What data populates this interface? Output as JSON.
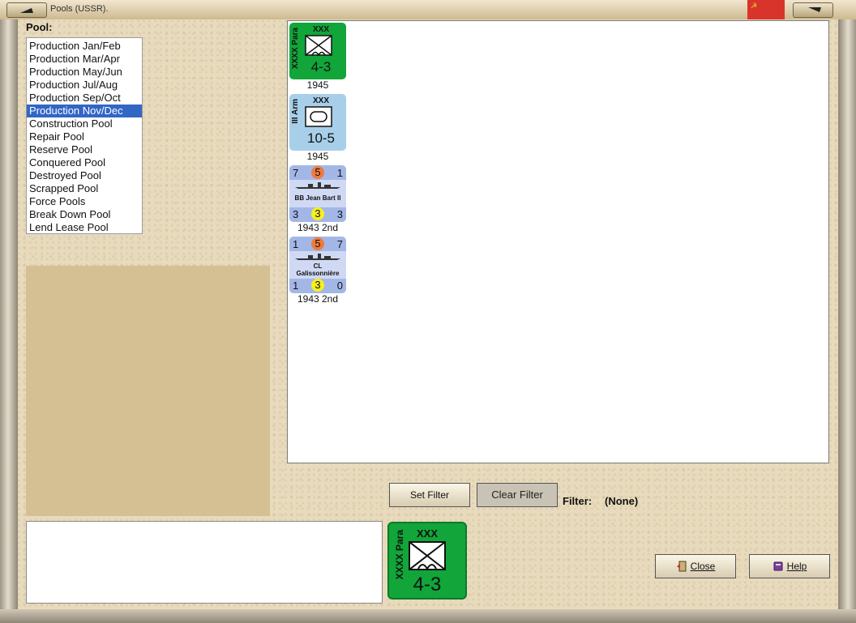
{
  "window": {
    "title": "Pools (USSR)."
  },
  "colors": {
    "selection": "#3166c5",
    "counter_green": "#11a53a",
    "counter_blue": "#a7cfea",
    "ship_blue": "#a3b7e7"
  },
  "pool": {
    "label": "Pool:",
    "selected_index": 5,
    "items": [
      "Production Jan/Feb",
      "Production Mar/Apr",
      "Production May/Jun",
      "Production Jul/Aug",
      "Production Sep/Oct",
      "Production Nov/Dec",
      "Construction Pool",
      "Repair Pool",
      "Reserve Pool",
      "Conquered Pool",
      "Destroyed Pool",
      "Scrapped Pool",
      "Force Pools",
      "Break Down Pool",
      "Lend Lease Pool"
    ]
  },
  "units": [
    {
      "kind": "land",
      "color": "green",
      "side": "XXXX Para",
      "size": "XXX",
      "symbol": "para-infantry",
      "strength": "4-3",
      "year": "1945"
    },
    {
      "kind": "land",
      "color": "lightblue",
      "side": "III Arm",
      "size": "XXX",
      "symbol": "armor",
      "strength": "10-5",
      "year": "1945"
    },
    {
      "kind": "ship",
      "top": [
        "7",
        "5",
        "1"
      ],
      "name": [
        "BB Jean Bart II"
      ],
      "bottom": [
        "3",
        "3",
        "3"
      ],
      "year": "1943 2nd"
    },
    {
      "kind": "ship",
      "top": [
        "1",
        "5",
        "7"
      ],
      "name": [
        "CL",
        "Galissonnière"
      ],
      "bottom": [
        "1",
        "3",
        "0"
      ],
      "year": "1943 2nd"
    }
  ],
  "filter": {
    "set_label": "Set Filter",
    "clear_label": "Clear Filter",
    "label": "Filter:",
    "value": "(None)"
  },
  "selected_unit": {
    "side": "XXXX Para",
    "size": "XXX",
    "strength": "4-3"
  },
  "buttons": {
    "close": "Close",
    "help": "Help"
  }
}
